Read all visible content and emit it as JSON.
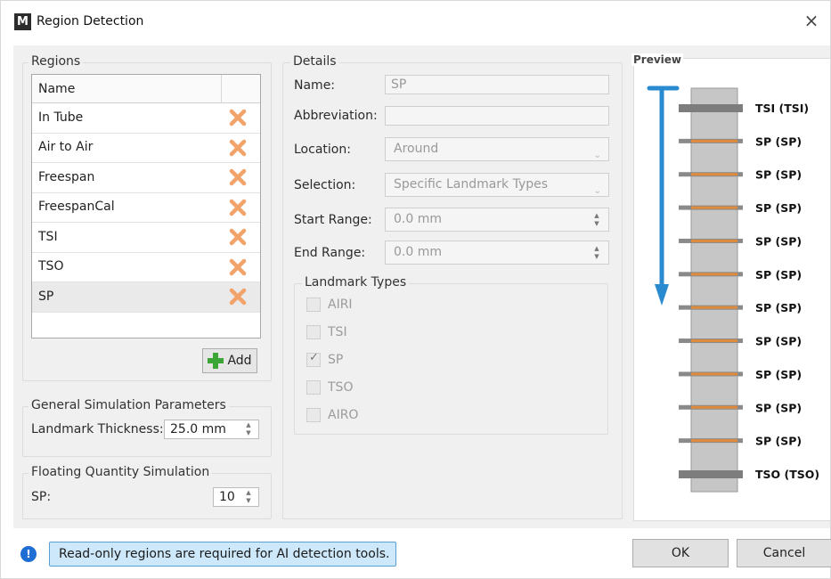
{
  "window": {
    "logo_letter": "M",
    "title": "Region Detection",
    "close_glyph": "×"
  },
  "regions": {
    "legend": "Regions",
    "column_header": "Name",
    "items": [
      {
        "name": "In Tube"
      },
      {
        "name": "Air to Air"
      },
      {
        "name": "Freespan"
      },
      {
        "name": "FreespanCal"
      },
      {
        "name": "TSI"
      },
      {
        "name": "TSO"
      },
      {
        "name": "SP"
      }
    ],
    "selected": "SP",
    "delete_icon": "x-delete-icon",
    "add_label": "Add"
  },
  "general_params": {
    "legend": "General Simulation Parameters",
    "landmark_thickness_label": "Landmark Thickness:",
    "landmark_thickness_value": "25.0 mm"
  },
  "floating": {
    "legend": "Floating Quantity Simulation",
    "sp_label": "SP:",
    "sp_value": "10"
  },
  "details": {
    "legend": "Details",
    "name_label": "Name:",
    "name_value": "SP",
    "abbreviation_label": "Abbreviation:",
    "abbreviation_value": "",
    "location_label": "Location:",
    "location_value": "Around",
    "selection_label": "Selection:",
    "selection_value": "Specific Landmark Types",
    "start_range_label": "Start Range:",
    "start_range_value": "0.0 mm",
    "end_range_label": "End Range:",
    "end_range_value": "0.0 mm",
    "landmark_types_legend": "Landmark Types",
    "landmark_types": [
      {
        "label": "AIRI",
        "checked": false
      },
      {
        "label": "TSI",
        "checked": false
      },
      {
        "label": "SP",
        "checked": true
      },
      {
        "label": "TSO",
        "checked": false
      },
      {
        "label": "AIRO",
        "checked": false
      }
    ]
  },
  "preview": {
    "legend": "Preview",
    "landmarks": [
      {
        "label": "TSI (TSI)",
        "kind": "ts"
      },
      {
        "label": "SP (SP)",
        "kind": "sp"
      },
      {
        "label": "SP (SP)",
        "kind": "sp"
      },
      {
        "label": "SP (SP)",
        "kind": "sp"
      },
      {
        "label": "SP (SP)",
        "kind": "sp"
      },
      {
        "label": "SP (SP)",
        "kind": "sp"
      },
      {
        "label": "SP (SP)",
        "kind": "sp"
      },
      {
        "label": "SP (SP)",
        "kind": "sp"
      },
      {
        "label": "SP (SP)",
        "kind": "sp"
      },
      {
        "label": "SP (SP)",
        "kind": "sp"
      },
      {
        "label": "SP (SP)",
        "kind": "sp"
      },
      {
        "label": "TSO (TSO)",
        "kind": "ts"
      }
    ],
    "colors": {
      "tube": "#c6c6c6",
      "plate": "#7d7d7d",
      "sp_stripe": "#e08a3c",
      "arrow": "#2a8ad0"
    }
  },
  "footer": {
    "info_text": "Read-only regions are required for AI detection tools.",
    "ok_label": "OK",
    "cancel_label": "Cancel"
  },
  "colors": {
    "info_icon": "#1f6ed4",
    "banner_bg": "#cde8fb",
    "delete_x": "#f2a36a"
  }
}
